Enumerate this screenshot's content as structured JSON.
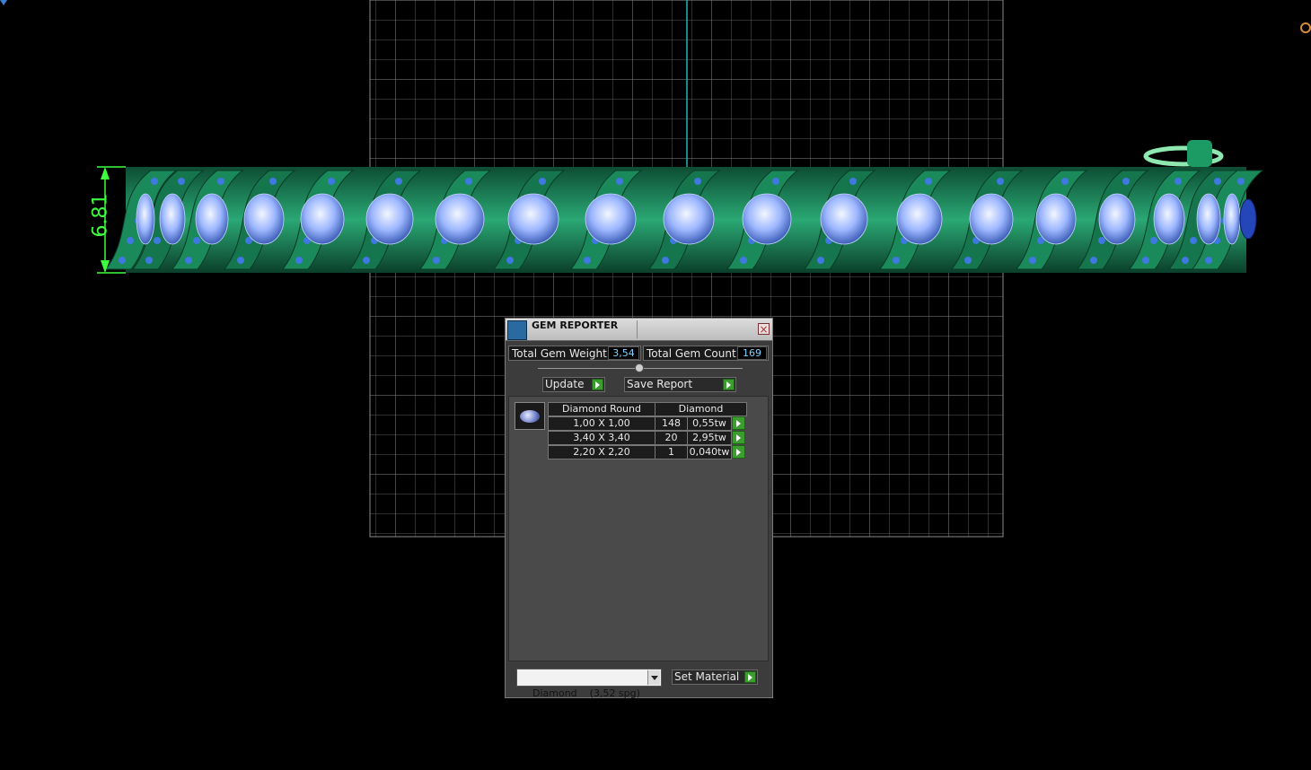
{
  "dimension_label": "6.81",
  "dialog": {
    "title": "GEM REPORTER",
    "total_weight_label": "Total Gem Weight",
    "total_weight_value": "3,54",
    "total_count_label": "Total Gem Count",
    "total_count_value": "169",
    "update_label": "Update",
    "save_report_label": "Save Report",
    "table": {
      "shape_header": "Diamond Round",
      "material_header": "Diamond",
      "rows": [
        {
          "size": "1,00 X 1,00",
          "count": "148",
          "weight": "0,55tw"
        },
        {
          "size": "3,40 X 3,40",
          "count": "20",
          "weight": "2,95tw"
        },
        {
          "size": "2,20 X 2,20",
          "count": "1",
          "weight": "0,040tw"
        }
      ]
    },
    "material_select": "Diamond    (3,52 spg)",
    "set_material_label": "Set Material"
  },
  "colors": {
    "background": "#000000",
    "grid": "#6e6e6e",
    "metal": "#1f8f5f",
    "gem": "#8fb3ff",
    "dimension": "#3dff3d"
  }
}
